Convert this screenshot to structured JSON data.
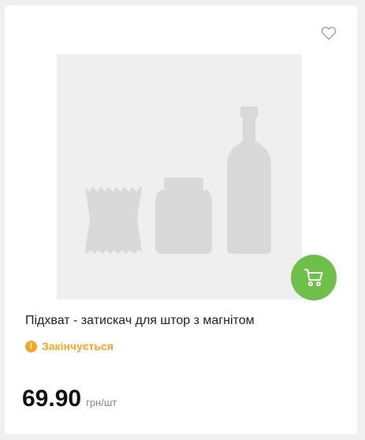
{
  "product": {
    "title": "Підхват - затискач для штор з магнітом",
    "status_text": "Закінчується",
    "status_icon": "!",
    "price": "69.90",
    "price_unit": "грн/шт"
  },
  "icons": {
    "favorite": "heart-outline-icon",
    "cart": "cart-icon",
    "status": "warning-circle-icon",
    "placeholder": "product-placeholder-image"
  },
  "colors": {
    "accent_green": "#6fc04a",
    "warning_orange": "#f5a623",
    "placeholder_bg": "#efefef",
    "placeholder_shape": "#d9d9d9"
  }
}
